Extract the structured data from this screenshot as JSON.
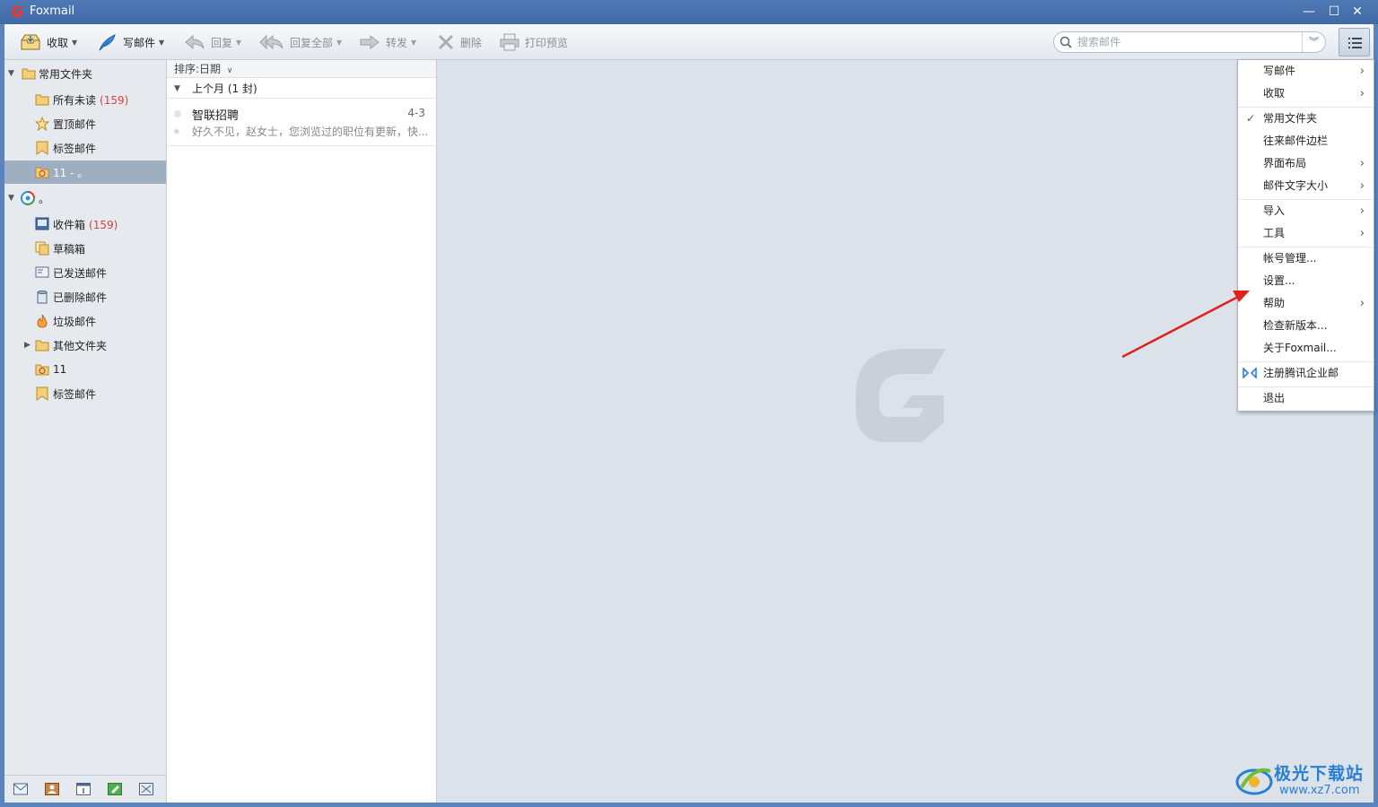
{
  "window": {
    "title": "Foxmail"
  },
  "toolbar": {
    "receive": "收取",
    "compose": "写邮件",
    "reply": "回复",
    "reply_all": "回复全部",
    "forward": "转发",
    "delete": "删除",
    "print_preview": "打印预览"
  },
  "search": {
    "placeholder": "搜索邮件"
  },
  "sidebar": {
    "favorites": {
      "label": "常用文件夹",
      "items": [
        {
          "label": "所有未读",
          "count": "(159)"
        },
        {
          "label": "置顶邮件"
        },
        {
          "label": "标签邮件"
        },
        {
          "label": "11 - 。"
        }
      ]
    },
    "account": {
      "label": "。",
      "items": [
        {
          "label": "收件箱",
          "count": "(159)"
        },
        {
          "label": "草稿箱"
        },
        {
          "label": "已发送邮件"
        },
        {
          "label": "已删除邮件"
        },
        {
          "label": "垃圾邮件"
        },
        {
          "label": "其他文件夹"
        },
        {
          "label": "11"
        },
        {
          "label": "标签邮件"
        }
      ]
    }
  },
  "maillist": {
    "sort_label": "排序:日期",
    "group_label": "上个月 (1 封)",
    "mails": [
      {
        "from": "智联招聘",
        "date": "4-3",
        "snippet": "好久不见，赵女士，您浏览过的职位有更新，快..."
      }
    ]
  },
  "menu": {
    "items": [
      "写邮件",
      "收取",
      "常用文件夹",
      "往来邮件边栏",
      "界面布局",
      "邮件文字大小",
      "导入",
      "工具",
      "帐号管理...",
      "设置...",
      "帮助",
      "检查新版本...",
      "关于Foxmail...",
      "注册腾讯企业邮",
      "退出"
    ]
  },
  "watermark": {
    "line1": "极光下载站",
    "line2": "www.xz7.com"
  },
  "colors": {
    "accent": "#4e79b4",
    "selected": "#9fafc2",
    "count": "#e23b3b",
    "annotation_arrow": "#e0201c"
  }
}
